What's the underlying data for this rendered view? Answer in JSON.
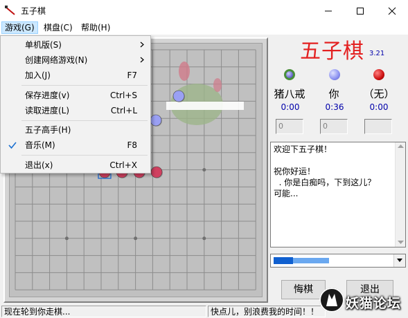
{
  "window": {
    "title": "五子棋",
    "icon": "gomoku-app-icon",
    "controls": [
      "minimize",
      "maximize",
      "close"
    ]
  },
  "menubar": {
    "items": [
      {
        "label": "游戏(G)",
        "active": true
      },
      {
        "label": "棋盘(C)",
        "active": false
      },
      {
        "label": "帮助(H)",
        "active": false
      }
    ]
  },
  "game_menu": {
    "items": [
      {
        "label": "单机版(S)",
        "shortcut": "",
        "submenu": true,
        "checked": false
      },
      {
        "label": "创建网络游戏(N)",
        "shortcut": "",
        "submenu": true,
        "checked": false
      },
      {
        "label": "加入(J)",
        "shortcut": "F7",
        "submenu": false,
        "checked": false
      },
      {
        "label": "保存进度(v)",
        "shortcut": "Ctrl+S",
        "submenu": false,
        "checked": false
      },
      {
        "label": "读取进度(L)",
        "shortcut": "Ctrl+L",
        "submenu": false,
        "checked": false
      },
      {
        "label": "五子高手(H)",
        "shortcut": "",
        "submenu": false,
        "checked": false
      },
      {
        "label": "音乐(M)",
        "shortcut": "F8",
        "submenu": false,
        "checked": true
      },
      {
        "label": "退出(x)",
        "shortcut": "Ctrl+X",
        "submenu": false,
        "checked": false
      }
    ]
  },
  "header": {
    "title": "五子棋",
    "version": "3.21",
    "title_color": "#e32020"
  },
  "players": [
    {
      "name": "猪八戒",
      "time": "0:00",
      "stone_color": "#4a8f3a",
      "field": "0"
    },
    {
      "name": "你",
      "time": "0:36",
      "stone_color": "#8a90f0",
      "field": "0"
    },
    {
      "name": "（无）",
      "time": "0:00",
      "stone_color": "#cc1010",
      "field": ""
    }
  ],
  "chat": {
    "messages": "欢迎下五子棋！\n\n祝你好运！\n  . 你是白痴吗，下到这儿？\n可能..."
  },
  "controls": {
    "undo_label": "悔棋",
    "exit_label": "退出"
  },
  "status": {
    "turn_message": "现在轮到你走棋...",
    "taunt": "快点儿，别浪费我的时间！！"
  },
  "watermark": {
    "text": "妖猫论坛"
  },
  "board": {
    "size": 15,
    "background": "#c0c0c0",
    "line_color": "#8c8c8c"
  }
}
